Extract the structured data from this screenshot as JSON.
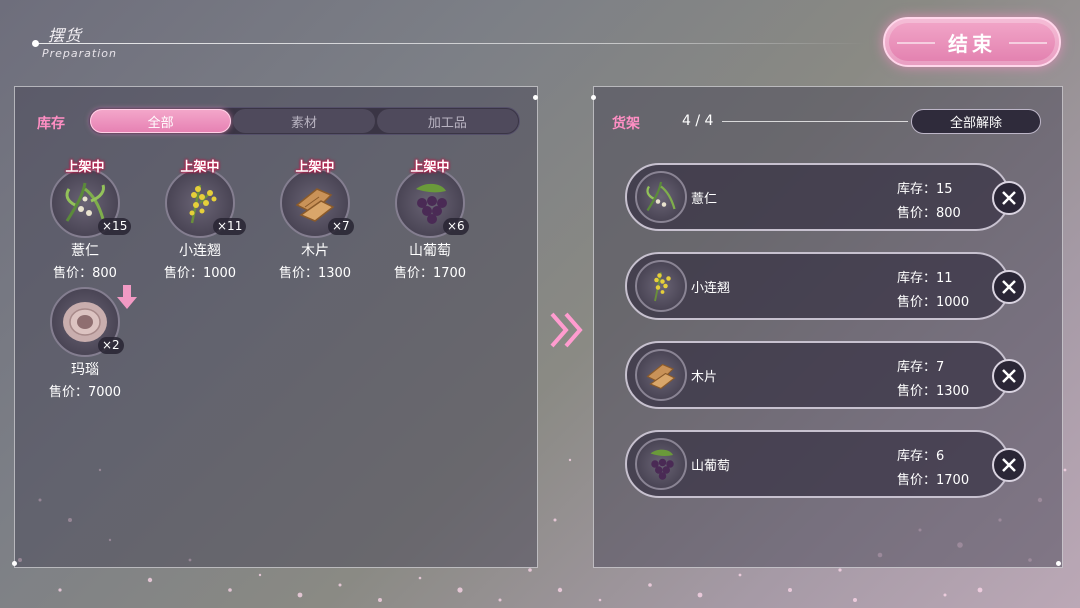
{
  "header": {
    "title": "摆货",
    "subtitle": "Preparation"
  },
  "end_button": {
    "label": "结束"
  },
  "inventory": {
    "label": "库存",
    "tabs": [
      {
        "label": "全部",
        "active": true
      },
      {
        "label": "素材",
        "active": false
      },
      {
        "label": "加工品",
        "active": false
      }
    ],
    "items": [
      {
        "status": "上架中",
        "icon": "coix-seed-icon",
        "count": "×15",
        "name": "薏仁",
        "price": "售价：800"
      },
      {
        "status": "上架中",
        "icon": "forsythia-icon",
        "count": "×11",
        "name": "小连翘",
        "price": "售价：1000"
      },
      {
        "status": "上架中",
        "icon": "wood-chip-icon",
        "count": "×7",
        "name": "木片",
        "price": "售价：1300"
      },
      {
        "status": "上架中",
        "icon": "wild-grape-icon",
        "count": "×6",
        "name": "山葡萄",
        "price": "售价：1700"
      },
      {
        "status": "",
        "icon": "agate-icon",
        "count": "×2",
        "name": "玛瑙",
        "price": "售价：7000"
      }
    ]
  },
  "shelf": {
    "label": "货架",
    "count": "4 / 4",
    "release_all_label": "全部解除",
    "items": [
      {
        "icon": "coix-seed-icon",
        "name": "薏仁",
        "stock": "库存：15",
        "price": "售价：800"
      },
      {
        "icon": "forsythia-icon",
        "name": "小连翘",
        "stock": "库存：11",
        "price": "售价：1000"
      },
      {
        "icon": "wood-chip-icon",
        "name": "木片",
        "stock": "库存：7",
        "price": "售价：1300"
      },
      {
        "icon": "wild-grape-icon",
        "name": "山葡萄",
        "stock": "库存：6",
        "price": "售价：1700"
      }
    ]
  },
  "colors": {
    "accent_pink": "#ff8fc4",
    "button_pink": "#e680b2",
    "panel": "#46425a"
  }
}
